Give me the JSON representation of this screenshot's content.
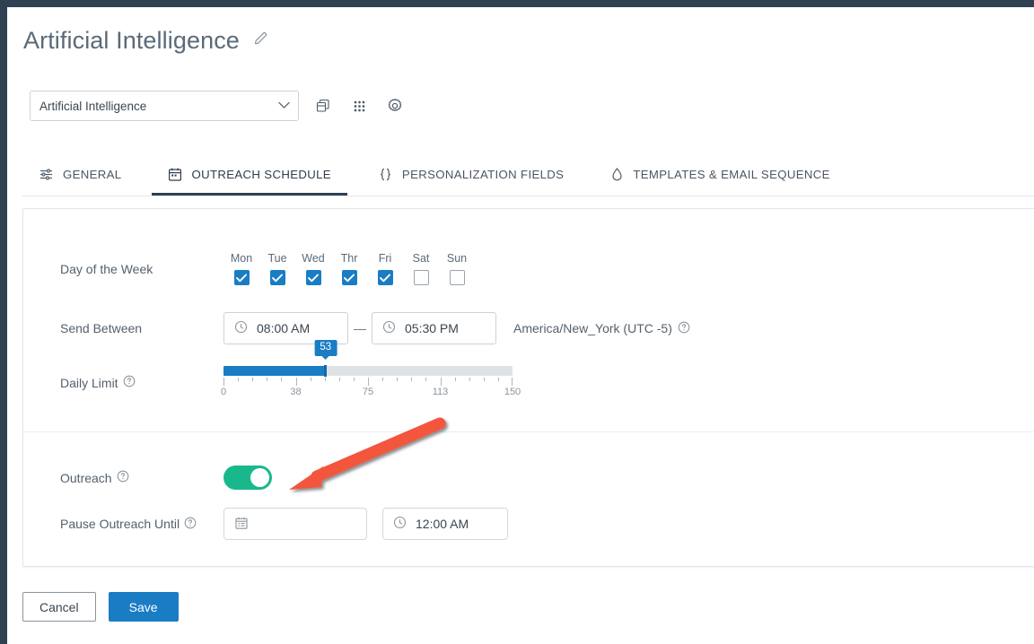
{
  "header": {
    "title": "Artificial Intelligence",
    "edit_icon": "pencil-icon"
  },
  "toolbar": {
    "dropdown_value": "Artificial Intelligence",
    "icons": [
      {
        "name": "duplicate-icon",
        "label": "Duplicate"
      },
      {
        "name": "grid-dots-icon",
        "label": "Apps"
      },
      {
        "name": "gear-icon",
        "label": "Settings"
      }
    ]
  },
  "tabs": [
    {
      "label": "GENERAL",
      "icon": "sliders-icon",
      "active": false
    },
    {
      "label": "OUTREACH SCHEDULE",
      "icon": "calendar-icon",
      "active": true
    },
    {
      "label": "PERSONALIZATION FIELDS",
      "icon": "braces-icon",
      "active": false
    },
    {
      "label": "TEMPLATES & EMAIL SEQUENCE",
      "icon": "droplet-icon",
      "active": false
    }
  ],
  "form": {
    "day_of_week": {
      "label": "Day of the Week",
      "days": [
        {
          "name": "Mon",
          "checked": true
        },
        {
          "name": "Tue",
          "checked": true
        },
        {
          "name": "Wed",
          "checked": true
        },
        {
          "name": "Thr",
          "checked": true
        },
        {
          "name": "Fri",
          "checked": true
        },
        {
          "name": "Sat",
          "checked": false
        },
        {
          "name": "Sun",
          "checked": false
        }
      ]
    },
    "send_between": {
      "label": "Send Between",
      "start_time": "08:00 AM",
      "end_time": "05:30 PM",
      "separator": "—",
      "timezone": "America/New_York (UTC -5)",
      "help_icon": "help-circle-icon",
      "clock_icon": "clock-icon"
    },
    "daily_limit": {
      "label": "Daily Limit",
      "help_icon": "help-circle-icon",
      "value": 53,
      "min": 0,
      "max": 150,
      "tick_labels": [
        "0",
        "38",
        "75",
        "113",
        "150"
      ]
    },
    "outreach": {
      "label": "Outreach",
      "help_icon": "help-circle-icon",
      "enabled": true,
      "state_text": "On"
    },
    "pause_outreach_until": {
      "label": "Pause Outreach Until",
      "help_icon": "help-circle-icon",
      "date_value": "",
      "date_placeholder": "",
      "calendar_icon": "calendar-icon",
      "time_value": "12:00 AM",
      "clock_icon": "clock-icon"
    }
  },
  "footer": {
    "cancel_label": "Cancel",
    "save_label": "Save"
  },
  "annotation": {
    "type": "arrow",
    "color": "#f4543c",
    "points": "from (490,472) to (327,542)"
  },
  "colors": {
    "accent_blue": "#1a7dc4",
    "toggle_green": "#19b88c",
    "chrome_dark": "#2e4052",
    "annotation_red": "#f4543c"
  },
  "chart_data": {
    "type": "bar",
    "title": "Daily Limit",
    "categories": [
      "0",
      "38",
      "75",
      "113",
      "150"
    ],
    "values": [
      53
    ],
    "xlabel": "",
    "ylabel": "",
    "ylim": [
      0,
      150
    ]
  }
}
